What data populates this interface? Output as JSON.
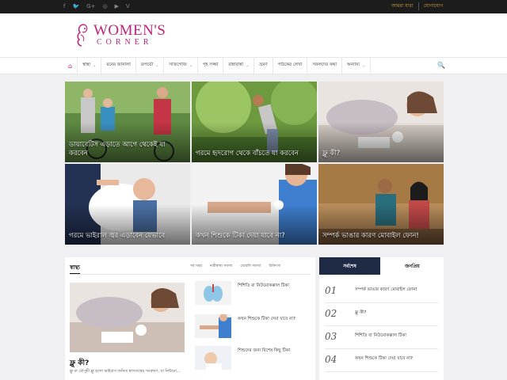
{
  "topbar": {
    "social_icons": [
      "facebook-icon",
      "twitter-icon",
      "google-plus-icon",
      "instagram-icon",
      "youtube-icon",
      "vimeo-icon"
    ],
    "social_glyphs": [
      "f",
      "🐦",
      "G+",
      "◎",
      "▶",
      "V"
    ],
    "links": [
      "আমরা যারা",
      "যোগাযোগ"
    ]
  },
  "logo": {
    "big": "WOMEN'S",
    "small": "CORNER"
  },
  "nav": {
    "home_glyph": "⌂",
    "items": [
      {
        "label": "স্বাস্থ্য",
        "caret": true
      },
      {
        "label": "মনের জানালা",
        "caret": false
      },
      {
        "label": "রূপচর্চা",
        "caret": true
      },
      {
        "label": "সাজগোজ",
        "caret": true
      },
      {
        "label": "গৃহ সজ্জা",
        "caret": false
      },
      {
        "label": "রান্নাবান্না",
        "caret": true
      },
      {
        "label": "ভ্রমণ",
        "caret": false
      },
      {
        "label": "পাঠকের লেখা",
        "caret": false
      },
      {
        "label": "সফলদের কথা",
        "caret": false
      },
      {
        "label": "অন্যান্য",
        "caret": true
      }
    ],
    "search_glyph": "🔍"
  },
  "tiles": [
    {
      "caption": "ডায়াবেটিস এড়াতে আগে থেকেই যা করবেন"
    },
    {
      "caption": "গরমে হৃদরোগ থেকে বাঁচতে যা করবেন"
    },
    {
      "caption": "ফ্লু কী?"
    },
    {
      "caption": "গরমে ভাইরাল জ্বর এড়াবেন যেভাবে"
    },
    {
      "caption": "কখন শিশুকে টিকা দেয়া যাবে না?"
    },
    {
      "caption": "সম্পর্ক ভাঙার কারণ মোবাইল ফোন!"
    }
  ],
  "panel": {
    "title": "স্বাস্থ্য",
    "tabs": [
      "সব খবর",
      "নারীস্বাস্থ্য সমস্যা",
      "মেয়েলি সমস্যা",
      "চিকিৎসা"
    ],
    "feature_title": "ফ্লু কী?",
    "feature_excerpt": "ফ্লু বা মৌসুমী ফ্লু হলো ভাইরাস জনিত শ্বাসতন্ত্রের সংক্রমণ, যা নিউমো...",
    "list": [
      {
        "title": "শিশিতি বা নিউমোকক্কাল টিকা"
      },
      {
        "title": "কখন শিশুকে টিকা দেয়া যাবে না?"
      },
      {
        "title": "শিশুদের জন্য বিশেষ কিছু টিকা"
      }
    ]
  },
  "sidebar": {
    "tabs": [
      "সর্বশেষ",
      "জনপ্রিয়"
    ],
    "items": [
      {
        "num": "01",
        "text": "সম্পর্ক ভাঙার কারণ মোবাইল ফোন!"
      },
      {
        "num": "02",
        "text": "ফ্লু কী?"
      },
      {
        "num": "03",
        "text": "শিশিতি বা নিউমোকক্কাল টিকা"
      },
      {
        "num": "04",
        "text": "কখন শিশুকে টিকা দেয়া যাবে না?"
      }
    ]
  },
  "colors": {
    "brand": "#c2237a",
    "topbar": "#1c1c1c",
    "tab_active": "#1f2a44",
    "toplink": "#d4a13a"
  }
}
